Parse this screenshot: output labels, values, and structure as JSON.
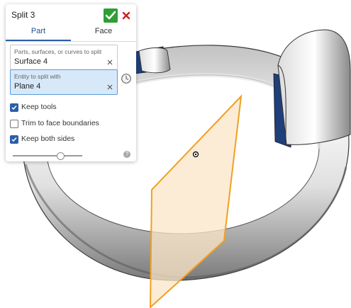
{
  "dialog": {
    "title": "Split 3",
    "accept_icon": "checkmark-icon",
    "cancel_icon": "close-icon",
    "tabs": [
      {
        "label": "Part",
        "active": true
      },
      {
        "label": "Face",
        "active": false
      }
    ],
    "parts_field": {
      "label": "Parts, surfaces, or curves to split",
      "value": "Surface 4"
    },
    "entity_field": {
      "label": "Entity to split with",
      "value": "Plane 4",
      "active": true
    },
    "history_icon": "history-icon",
    "options": [
      {
        "label": "Keep tools",
        "checked": true
      },
      {
        "label": "Trim to face boundaries",
        "checked": false
      },
      {
        "label": "Keep both sides",
        "checked": true
      }
    ],
    "slider": {
      "value": 0.68
    },
    "help_icon": "help-icon"
  },
  "colors": {
    "accept": "#2e9e35",
    "cancel": "#cc1f1f",
    "accent": "#2a5fa8",
    "active_field": "#d7e8f9",
    "plane_fill": "#fbe6c8",
    "plane_edge": "#f0a020",
    "ring_band": "#1f3f7a"
  }
}
